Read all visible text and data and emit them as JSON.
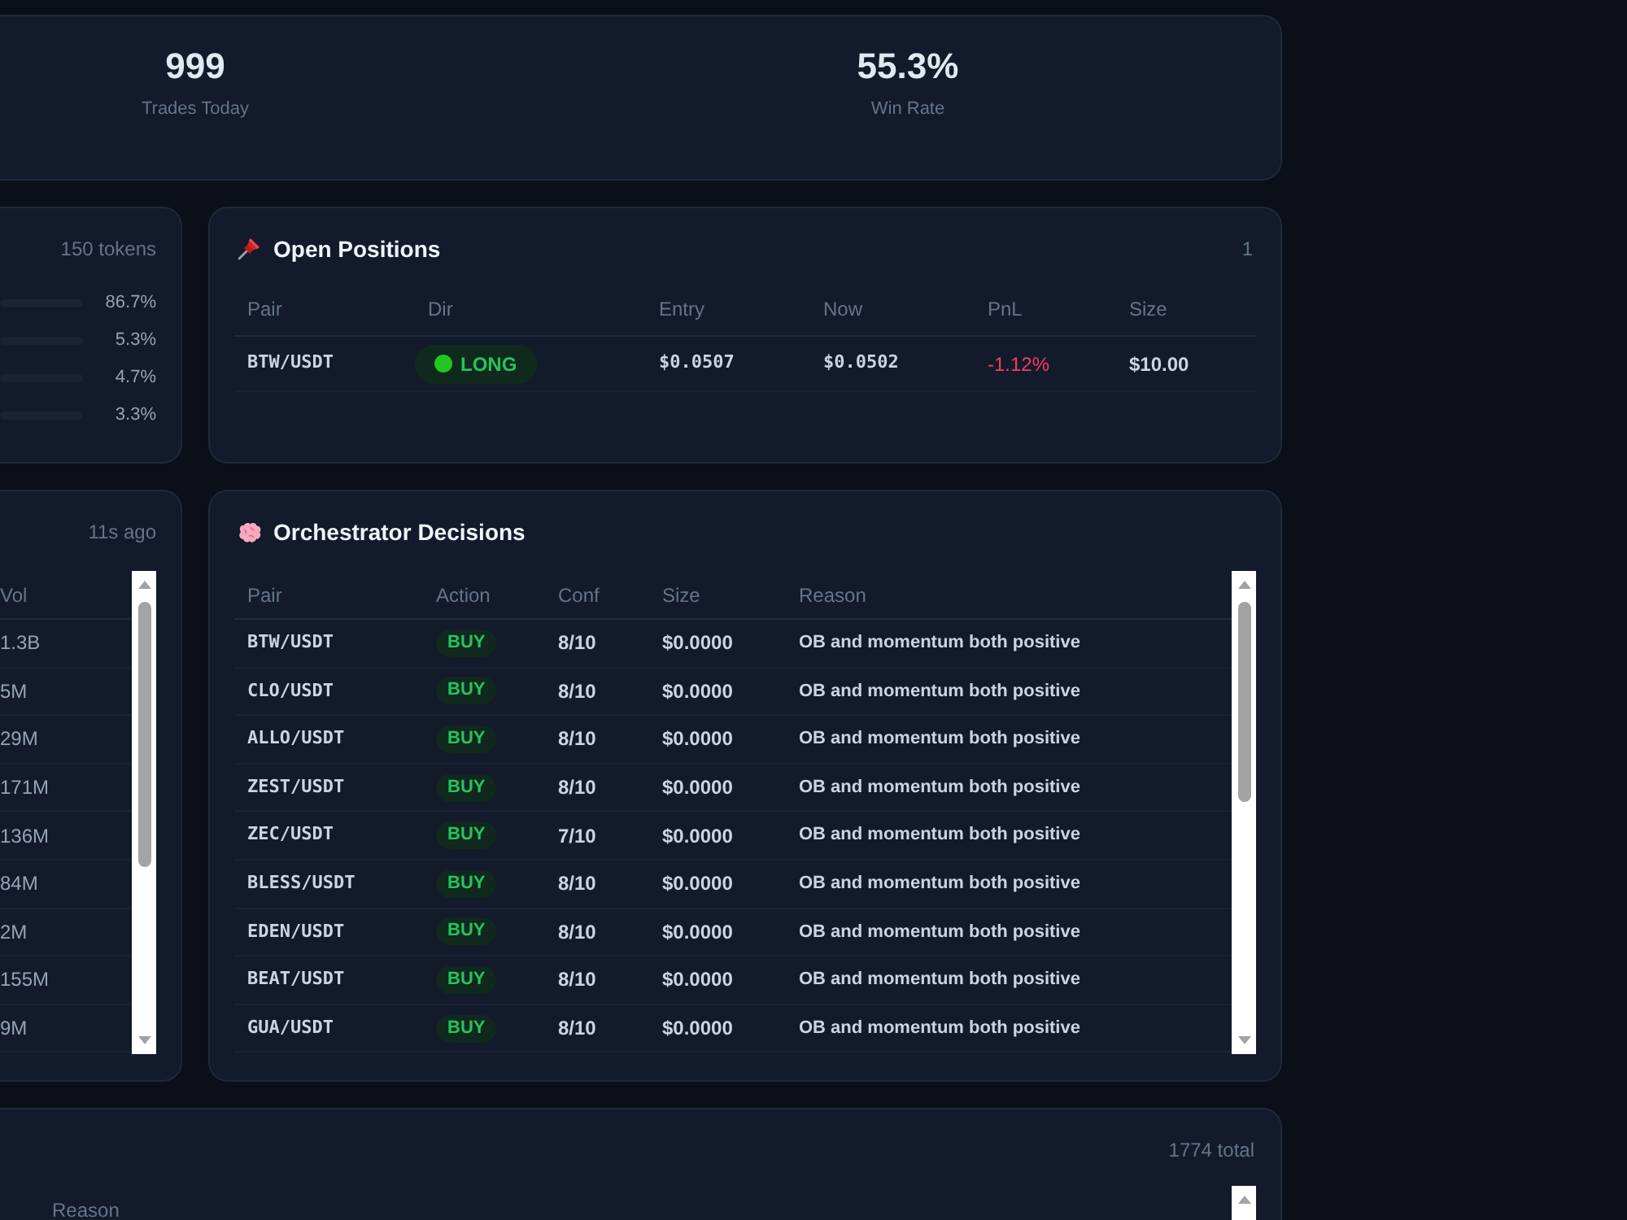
{
  "stats": [
    {
      "value": "999",
      "label": "Trades Today"
    },
    {
      "value": "55.3%",
      "label": "Win Rate"
    }
  ],
  "token_panel": {
    "count": "150 tokens",
    "rows": [
      {
        "share": "86.7%"
      },
      {
        "share": "5.3%"
      },
      {
        "share": "4.7%"
      },
      {
        "share": "3.3%"
      }
    ]
  },
  "open_positions": {
    "title": "Open Positions",
    "count": "1",
    "columns": [
      "Pair",
      "Dir",
      "Entry",
      "Now",
      "PnL",
      "Size"
    ],
    "rows": [
      {
        "pair": "BTW/USDT",
        "dir": "LONG",
        "kind": "long",
        "entry": "$0.0507",
        "now": "$0.0502",
        "pnl": "-1.12%",
        "loss": true,
        "size": "$10.00"
      }
    ]
  },
  "volume_panel": {
    "updated": "11s ago",
    "column": "Vol",
    "rows": [
      "1.3B",
      "5M",
      "29M",
      "171M",
      "136M",
      "84M",
      "2M",
      "155M",
      "9M"
    ]
  },
  "decisions": {
    "title": "Orchestrator Decisions",
    "columns": [
      "Pair",
      "Action",
      "Conf",
      "Size",
      "Reason"
    ],
    "rows": [
      {
        "pair": "BTW/USDT",
        "action": "BUY",
        "kind": "buy",
        "conf": "8/10",
        "size": "$0.0000",
        "reason": "OB and momentum both positive"
      },
      {
        "pair": "CLO/USDT",
        "action": "BUY",
        "kind": "buy",
        "conf": "8/10",
        "size": "$0.0000",
        "reason": "OB and momentum both positive"
      },
      {
        "pair": "ALLO/USDT",
        "action": "BUY",
        "kind": "buy",
        "conf": "8/10",
        "size": "$0.0000",
        "reason": "OB and momentum both positive"
      },
      {
        "pair": "ZEST/USDT",
        "action": "BUY",
        "kind": "buy",
        "conf": "8/10",
        "size": "$0.0000",
        "reason": "OB and momentum both positive"
      },
      {
        "pair": "ZEC/USDT",
        "action": "BUY",
        "kind": "buy",
        "conf": "7/10",
        "size": "$0.0000",
        "reason": "OB and momentum both positive"
      },
      {
        "pair": "BLESS/USDT",
        "action": "BUY",
        "kind": "buy",
        "conf": "8/10",
        "size": "$0.0000",
        "reason": "OB and momentum both positive"
      },
      {
        "pair": "EDEN/USDT",
        "action": "BUY",
        "kind": "buy",
        "conf": "8/10",
        "size": "$0.0000",
        "reason": "OB and momentum both positive"
      },
      {
        "pair": "BEAT/USDT",
        "action": "BUY",
        "kind": "buy",
        "conf": "8/10",
        "size": "$0.0000",
        "reason": "OB and momentum both positive"
      },
      {
        "pair": "GUA/USDT",
        "action": "BUY",
        "kind": "buy",
        "conf": "8/10",
        "size": "$0.0000",
        "reason": "OB and momentum both positive"
      }
    ]
  },
  "history": {
    "count": "1774 total",
    "columns": [
      "Reason"
    ]
  }
}
